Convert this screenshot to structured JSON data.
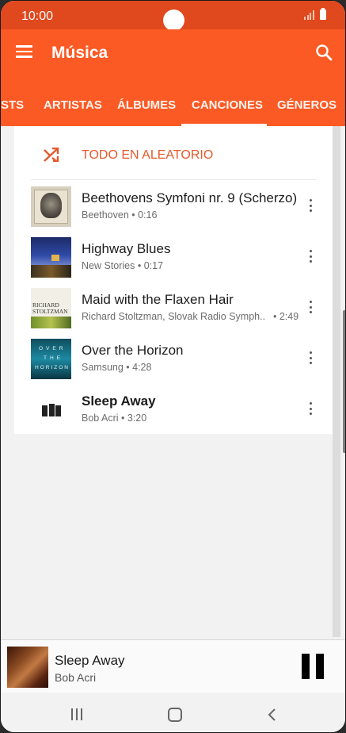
{
  "status_bar": {
    "time": "10:00"
  },
  "app_bar": {
    "title": "Música",
    "menu_icon": "hamburger-menu-icon",
    "search_icon": "search-icon"
  },
  "tabs": [
    {
      "label": "STS",
      "selected": false
    },
    {
      "label": "ARTISTAS",
      "selected": false
    },
    {
      "label": "ÁLBUMES",
      "selected": false
    },
    {
      "label": "CANCIONES",
      "selected": true
    },
    {
      "label": "GÉNEROS",
      "selected": false
    }
  ],
  "shuffle": {
    "label": "TODO EN ALEATORIO",
    "icon": "shuffle-icon"
  },
  "songs": [
    {
      "title": "Beethovens Symfoni nr. 9 (Scherzo)",
      "subtitle": "Beethoven • 0:16"
    },
    {
      "title": "Highway Blues",
      "subtitle": "New Stories • 0:17"
    },
    {
      "title": "Maid with the Flaxen Hair",
      "subtitle": "Richard Stoltzman, Slovak Radio Symph..",
      "duration": "• 2:49"
    },
    {
      "title": "Over the Horizon",
      "subtitle": "Samsung • 4:28"
    },
    {
      "title": "Sleep Away",
      "subtitle": "Bob Acri • 3:20",
      "playing": true
    }
  ],
  "album_art_text": {
    "maid_line1": "RICHARD",
    "maid_line2": "STOLTZMAN",
    "horizon_line1": "OVER",
    "horizon_line2": "THE",
    "horizon_line3": "HORIZON"
  },
  "mini_player": {
    "title": "Sleep Away",
    "artist": "Bob Acri"
  },
  "colors": {
    "accent": "#fb5a24",
    "status_bar": "#e0481d",
    "shuffle_text": "#e5592c"
  }
}
